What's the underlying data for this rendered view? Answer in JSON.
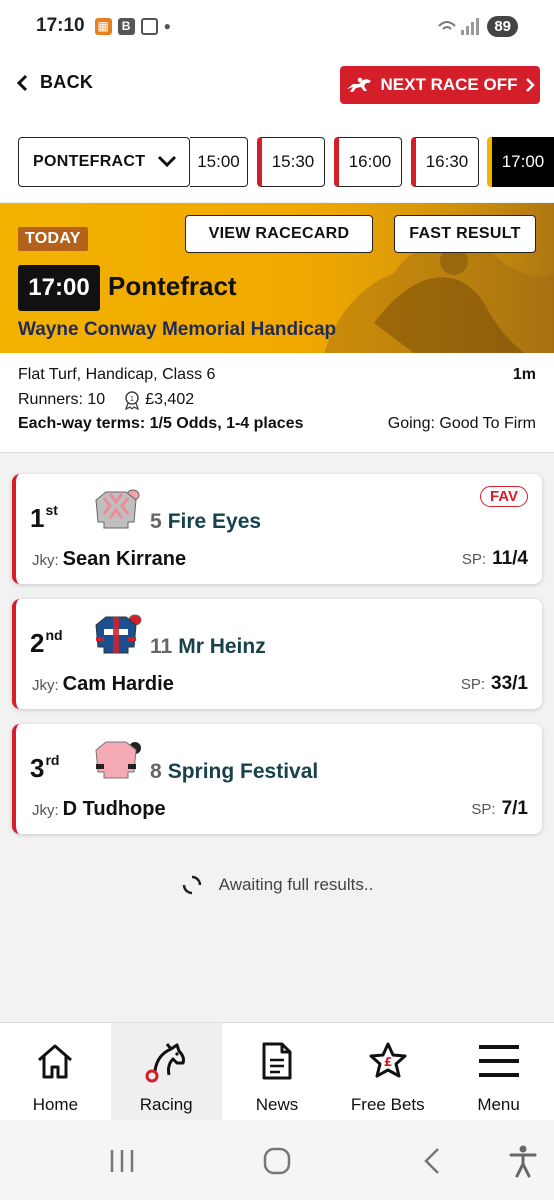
{
  "status_bar": {
    "time": "17:10",
    "battery": "89"
  },
  "top_nav": {
    "back_label": "BACK",
    "next_race_label": "NEXT RACE OFF"
  },
  "race_times": {
    "course": "PONTEFRACT",
    "times": [
      "15:00",
      "15:30",
      "16:00",
      "16:30",
      "17:00"
    ],
    "selected": "17:00"
  },
  "hero": {
    "badge": "TODAY",
    "view_racecard_label": "VIEW RACECARD",
    "fast_result_label": "FAST RESULT",
    "time": "17:00",
    "course": "Pontefract",
    "race_name": "Wayne Conway Memorial Handicap"
  },
  "race_info": {
    "type": "Flat Turf, Handicap, Class 6",
    "distance": "1m",
    "runners": "Runners: 10",
    "prize": "£3,402",
    "each_way": "Each-way terms: 1/5 Odds, 1-4 places",
    "going": "Going: Good To Firm"
  },
  "results": [
    {
      "pos": "1",
      "suffix": "st",
      "number": "5",
      "horse": "Fire Eyes",
      "jockey_label": "Jky:",
      "jockey": "Sean Kirrane",
      "sp_label": "SP:",
      "sp": "11/4",
      "fav": "FAV"
    },
    {
      "pos": "2",
      "suffix": "nd",
      "number": "11",
      "horse": "Mr Heinz",
      "jockey_label": "Jky:",
      "jockey": "Cam Hardie",
      "sp_label": "SP:",
      "sp": "33/1"
    },
    {
      "pos": "3",
      "suffix": "rd",
      "number": "8",
      "horse": "Spring Festival",
      "jockey_label": "Jky:",
      "jockey": "D Tudhope",
      "sp_label": "SP:",
      "sp": "7/1"
    }
  ],
  "awaiting_text": "Awaiting full results..",
  "bottom_nav": [
    {
      "label": "Home",
      "icon": "home-icon"
    },
    {
      "label": "Racing",
      "icon": "racing-icon"
    },
    {
      "label": "News",
      "icon": "news-icon"
    },
    {
      "label": "Free Bets",
      "icon": "free-bets-icon"
    },
    {
      "label": "Menu",
      "icon": "menu-icon"
    }
  ],
  "colors": {
    "brand_red": "#d41f2b",
    "hero_yellow": "#f3b200",
    "today_badge": "#b4621b",
    "horse_name": "#17424a"
  }
}
